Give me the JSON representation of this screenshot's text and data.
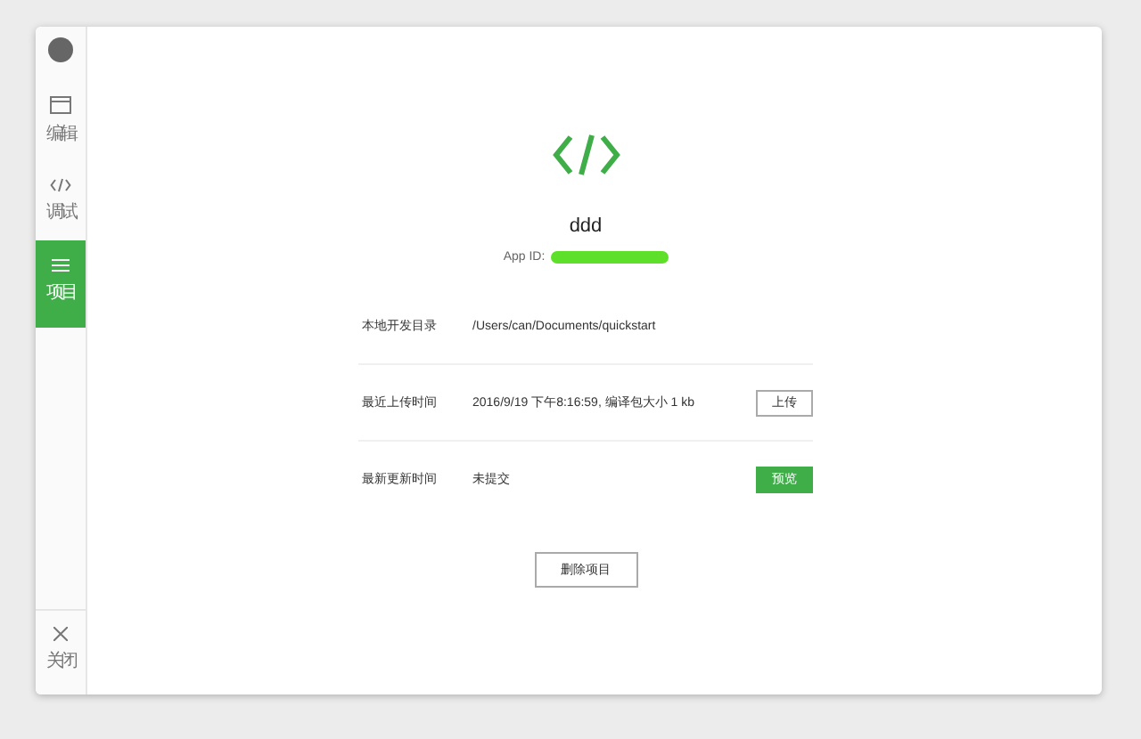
{
  "sidebar": {
    "items": [
      {
        "kind": "edit",
        "label": "编辑",
        "selected": false
      },
      {
        "kind": "debug",
        "label": "调试",
        "selected": false
      },
      {
        "kind": "project",
        "label": "项目",
        "selected": true
      }
    ],
    "close": {
      "label": "关闭"
    }
  },
  "project": {
    "name": "ddd",
    "app_id_label": "App ID:"
  },
  "rows": [
    {
      "label": "本地开发目录",
      "value": "/Users/can/Documents/quickstart"
    },
    {
      "label": "最近上传时间",
      "value": "2016/9/19 下午8:16:59, 编译包大小 1 kb",
      "button": {
        "label": "上传",
        "kind": "outline"
      }
    },
    {
      "label": "最新更新时间",
      "value": "未提交",
      "button": {
        "label": "预览",
        "kind": "primary"
      }
    }
  ],
  "delete_button": "删除项目"
}
